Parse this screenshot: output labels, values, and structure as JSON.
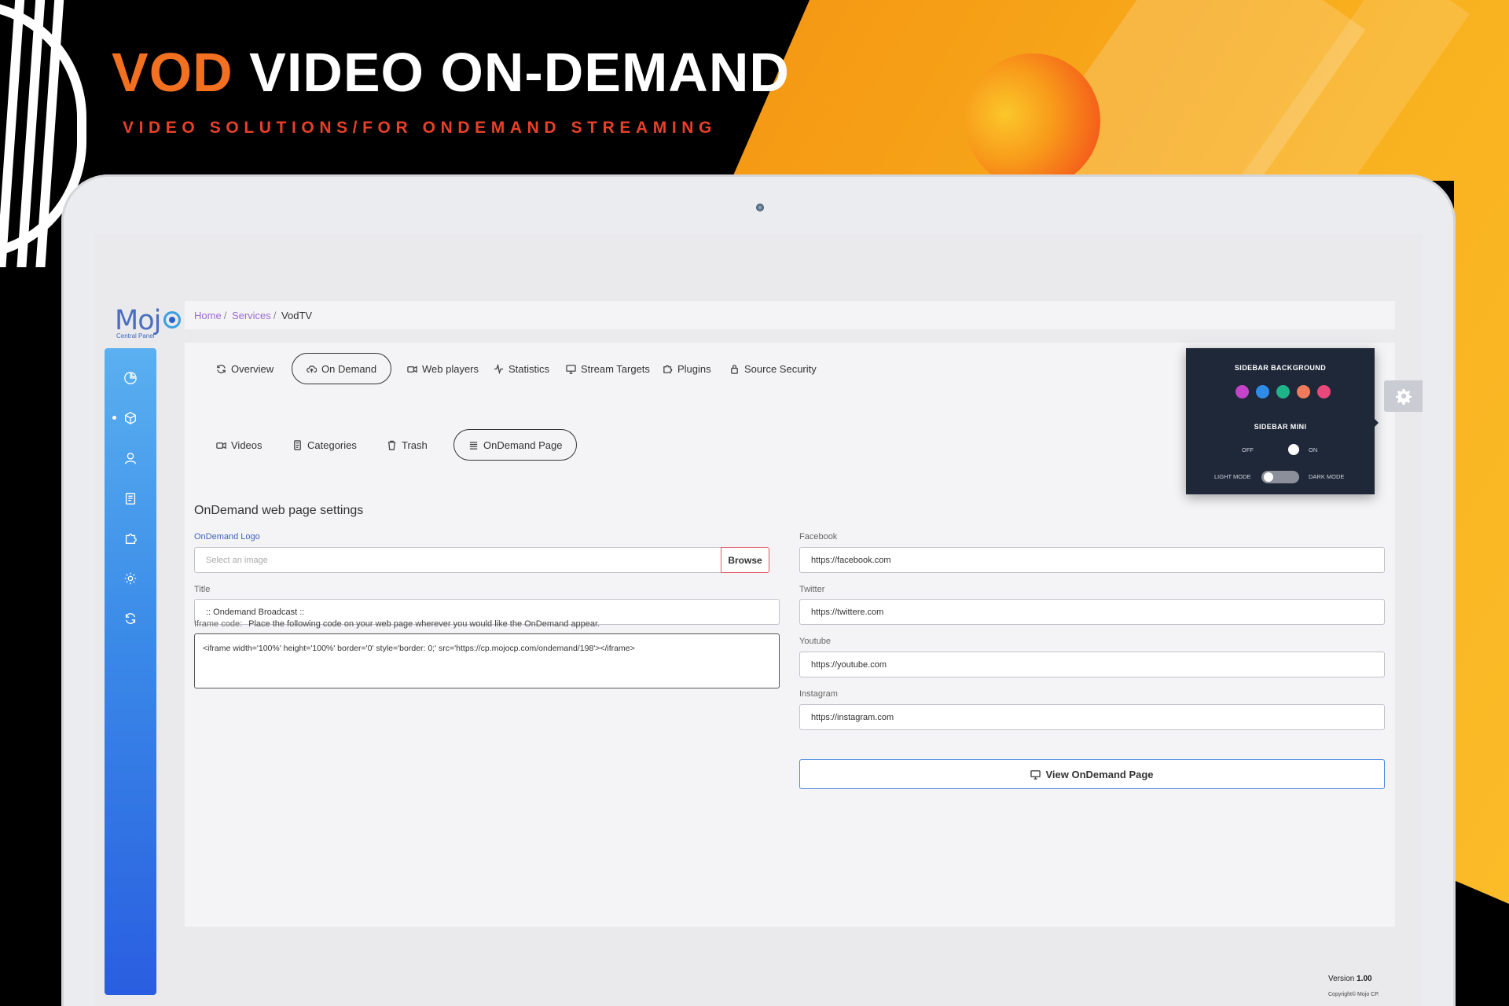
{
  "hero": {
    "title_accent": "VOD",
    "title_rest": "VIDEO ON-DEMAND",
    "subtitle": "VIDEO SOLUTIONS/FOR ONDEMAND STREAMING"
  },
  "brand": {
    "name": "Moj",
    "tagline": "Central Panel"
  },
  "sidebar": {
    "items": [
      {
        "icon": "pie-chart-icon"
      },
      {
        "icon": "box-icon",
        "active": true
      },
      {
        "icon": "user-icon"
      },
      {
        "icon": "clipboard-icon"
      },
      {
        "icon": "puzzle-icon"
      },
      {
        "icon": "gear-icon"
      },
      {
        "icon": "refresh-icon"
      }
    ]
  },
  "breadcrumb": {
    "home": "Home",
    "services": "Services",
    "current": "VodTV"
  },
  "tabs": {
    "overview": "Overview",
    "on_demand": "On Demand",
    "web_players": "Web players",
    "statistics": "Statistics",
    "stream_targets": "Stream Targets",
    "plugins": "Plugins",
    "source_security": "Source Security"
  },
  "subtabs": {
    "videos": "Videos",
    "categories": "Categories",
    "trash": "Trash",
    "ondemand_page": "OnDemand Page"
  },
  "form": {
    "section_title": "OnDemand web page settings",
    "logo_label": "OnDemand Logo",
    "logo_placeholder": "Select an image",
    "browse_label": "Browse",
    "title_label": "Title",
    "title_value": ":: Ondemand Broadcast ::",
    "iframe_label": "Iframe code:",
    "iframe_help": "Place the following code on your web page wherever you would like the OnDemand appear.",
    "iframe_value": "<iframe width='100%' height='100%' border='0' style='border: 0;' src='https://cp.mojocp.com/ondemand/198'></iframe>",
    "facebook_label": "Facebook",
    "facebook_value": "https://facebook.com",
    "twitter_label": "Twitter",
    "twitter_value": "https://twittere.com",
    "youtube_label": "Youtube",
    "youtube_value": "https://youtube.com",
    "instagram_label": "Instagram",
    "instagram_value": "https://instagram.com",
    "view_button": "View OnDemand Page"
  },
  "settings_popup": {
    "sidebar_bg_title": "SIDEBAR BACKGROUND",
    "swatches": [
      "#c444c9",
      "#2f8be8",
      "#1fb38a",
      "#f07a5a",
      "#e8487a"
    ],
    "sidebar_mini_title": "SIDEBAR MINI",
    "off_label": "OFF",
    "on_label": "ON",
    "light_mode_label": "LIGHT MODE",
    "dark_mode_label": "DARK MODE"
  },
  "footer": {
    "version_label": "Version",
    "version_value": "1.00",
    "copyright": "Copyright© Mojo CP."
  }
}
